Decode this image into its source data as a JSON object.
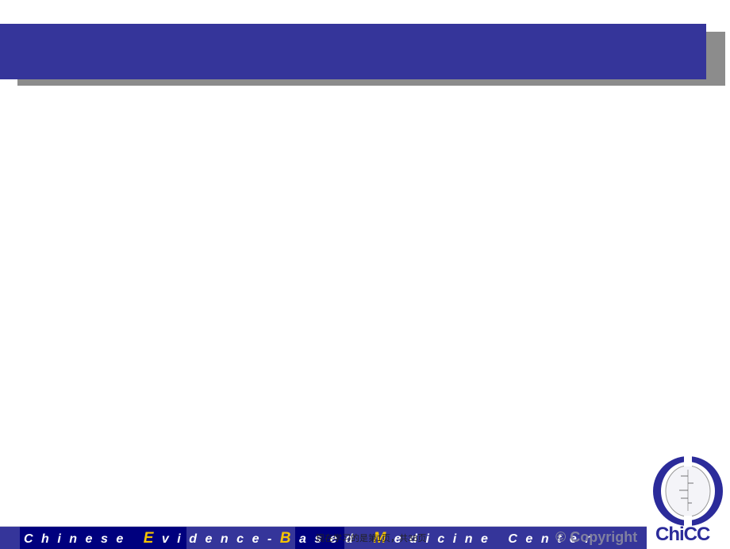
{
  "footer": {
    "words": [
      {
        "first": "E",
        "rest": "vidence-"
      },
      {
        "first": "B",
        "rest": "ased "
      },
      {
        "first": "M",
        "rest": "edicine Center"
      }
    ],
    "prefix": "Chinese ",
    "copyright": "© Copyright"
  },
  "page_indicator": "现在学习的是第1页，共38页",
  "logo": {
    "text": "ChiCC",
    "color": "#2b2b9a"
  },
  "colors": {
    "banner": "#35359a",
    "footer_dark": "#00007e",
    "accent": "#f5c400"
  }
}
